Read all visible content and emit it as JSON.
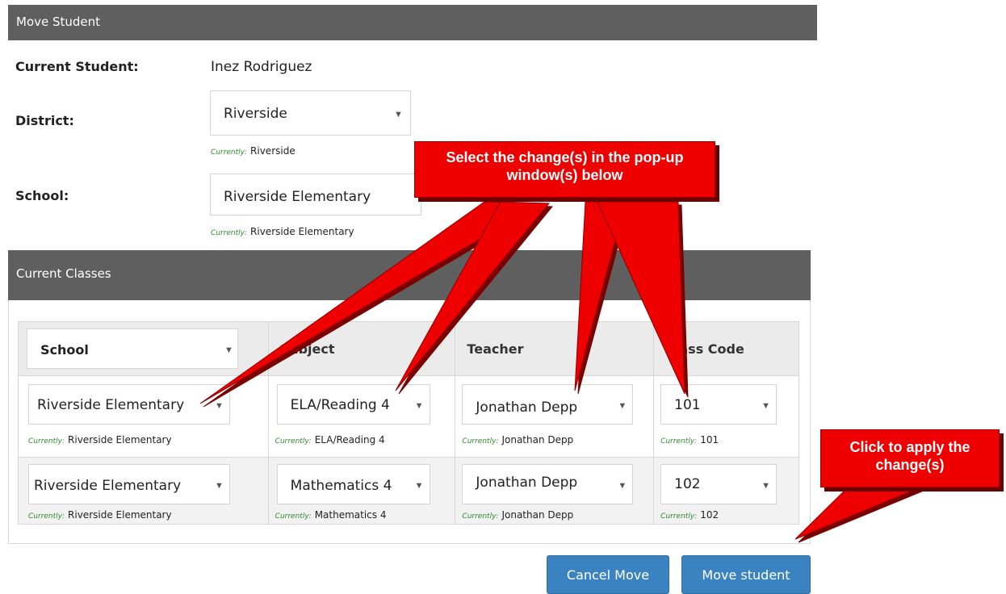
{
  "header": {
    "title": "Move Student"
  },
  "form": {
    "current_student_label": "Current Student:",
    "current_student_value": "Inez Rodriguez",
    "district_label": "District:",
    "district_value": "Riverside",
    "district_currently_prefix": "Currently:",
    "district_currently_value": "Riverside",
    "school_label": "School:",
    "school_value": "Riverside Elementary",
    "school_currently_prefix": "Currently:",
    "school_currently_value": "Riverside Elementary"
  },
  "classes": {
    "title": "Current Classes",
    "headers": {
      "school": "School",
      "subject": "Subject",
      "teacher": "Teacher",
      "class_code": "Class Code"
    },
    "rows": [
      {
        "school": "Riverside Elementary",
        "subject": "ELA/Reading 4",
        "teacher": "Jonathan Depp",
        "class_code": "101",
        "currently_prefix": "Currently:",
        "cur_school": "Riverside Elementary",
        "cur_subject": "ELA/Reading 4",
        "cur_teacher": "Jonathan Depp",
        "cur_class_code": "101"
      },
      {
        "school": "Riverside Elementary",
        "subject": "Mathematics 4",
        "teacher": "Jonathan Depp",
        "class_code": "102",
        "currently_prefix": "Currently:",
        "cur_school": "Riverside Elementary",
        "cur_subject": "Mathematics 4",
        "cur_teacher": "Jonathan Depp",
        "cur_class_code": "102"
      }
    ]
  },
  "buttons": {
    "cancel": "Cancel Move",
    "move": "Move student"
  },
  "callouts": {
    "select_changes": "Select the change(s) in the pop-up window(s) below",
    "apply_changes": "Click to apply the change(s)"
  },
  "colors": {
    "header_bar": "#5f5f5f",
    "button": "#3a82c0",
    "callout": "#ee0000",
    "currently_text": "#2f8a2f"
  }
}
